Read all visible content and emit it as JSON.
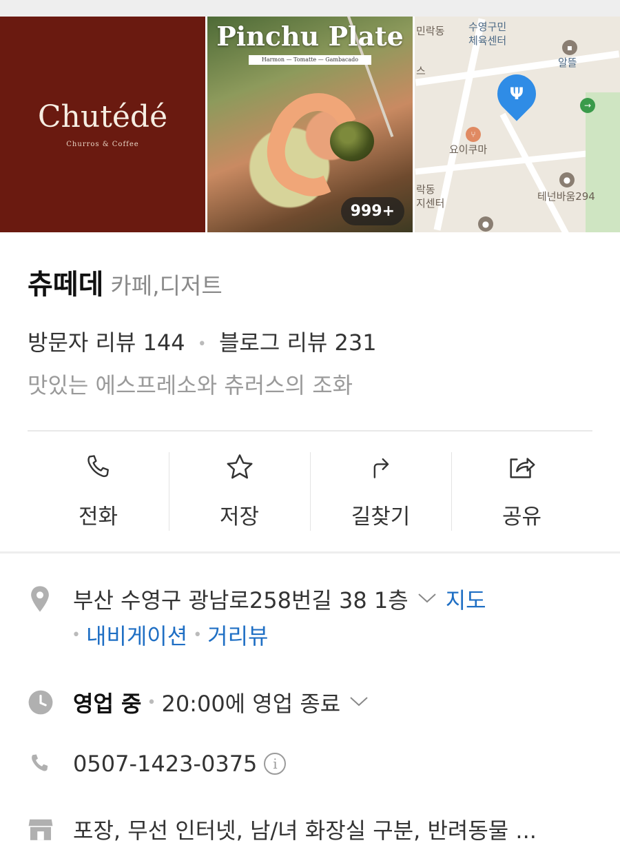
{
  "gallery": {
    "logo_title": "Chutédé",
    "logo_subtitle": "Churros & Coffee",
    "food_title": "Pinchu Plate",
    "food_subtitle": "Harmon — Tomatte — Gambacado",
    "photo_count": "999+",
    "map_labels": [
      "민락동",
      "수영구민",
      "체육센터",
      "알뜰",
      "요이쿠마",
      "락동",
      "지센터",
      "테넌바움294",
      "스"
    ]
  },
  "place": {
    "name": "츄떼데",
    "category": "카페,디저트",
    "visitor_reviews": "방문자 리뷰 144",
    "blog_reviews": "블로그 리뷰 231",
    "separator": "•",
    "description": "맛있는 에스프레소와 츄러스의 조화"
  },
  "actions": [
    {
      "label": "전화",
      "icon": "phone-icon"
    },
    {
      "label": "저장",
      "icon": "star-icon"
    },
    {
      "label": "길찾기",
      "icon": "directions-icon"
    },
    {
      "label": "공유",
      "icon": "share-icon"
    }
  ],
  "info": {
    "address": "부산 수영구 광남로258번길 38 1층",
    "map_link": "지도",
    "navigation_link": "내비게이션",
    "streetview_link": "거리뷰",
    "status": "영업 중",
    "hours": "20:00에 영업 종료",
    "phone": "0507-1423-0375",
    "phone_info": "i",
    "amenities": "포장, 무선 인터넷, 남/녀 화장실 구분, 반려동물 ..."
  },
  "colors": {
    "brand_maroon": "#6a1a10",
    "link_blue": "#1f6fc4",
    "map_pin_blue": "#2f8ce6",
    "icon_gray": "#9a9a9a"
  }
}
